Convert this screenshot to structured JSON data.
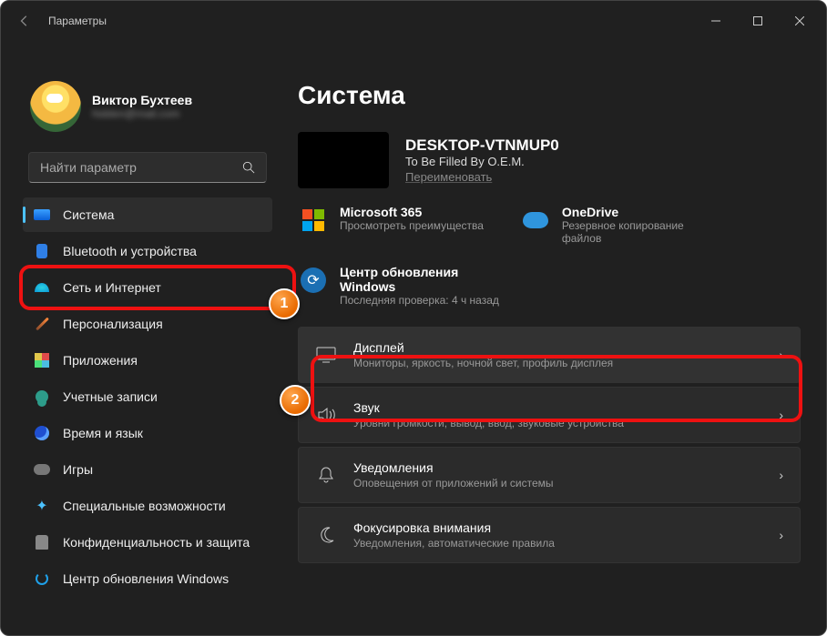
{
  "titlebar": {
    "title": "Параметры"
  },
  "user": {
    "name": "Виктор Бухтеев",
    "email": "hidden@mail.com"
  },
  "search": {
    "placeholder": "Найти параметр"
  },
  "sidebar": {
    "items": [
      {
        "label": "Система"
      },
      {
        "label": "Bluetooth и устройства"
      },
      {
        "label": "Сеть и Интернет"
      },
      {
        "label": "Персонализация"
      },
      {
        "label": "Приложения"
      },
      {
        "label": "Учетные записи"
      },
      {
        "label": "Время и язык"
      },
      {
        "label": "Игры"
      },
      {
        "label": "Специальные возможности"
      },
      {
        "label": "Конфиденциальность и защита"
      },
      {
        "label": "Центр обновления Windows"
      }
    ]
  },
  "main": {
    "heading": "Система",
    "device": {
      "name": "DESKTOP-VTNMUP0",
      "oem": "To Be Filled By O.E.M.",
      "rename": "Переименовать"
    },
    "cards": {
      "ms365": {
        "title": "Microsoft 365",
        "sub": "Просмотреть преимущества"
      },
      "onedrive": {
        "title": "OneDrive",
        "sub": "Резервное копирование файлов"
      },
      "update": {
        "title": "Центр обновления Windows",
        "sub": "Последняя проверка: 4 ч назад"
      }
    },
    "list": [
      {
        "title": "Дисплей",
        "sub": "Мониторы, яркость, ночной свет, профиль дисплея"
      },
      {
        "title": "Звук",
        "sub": "Уровни громкости, вывод, ввод, звуковые устройства"
      },
      {
        "title": "Уведомления",
        "sub": "Оповещения от приложений и системы"
      },
      {
        "title": "Фокусировка внимания",
        "sub": "Уведомления, автоматические правила"
      }
    ]
  },
  "steps": {
    "one": "1",
    "two": "2"
  }
}
